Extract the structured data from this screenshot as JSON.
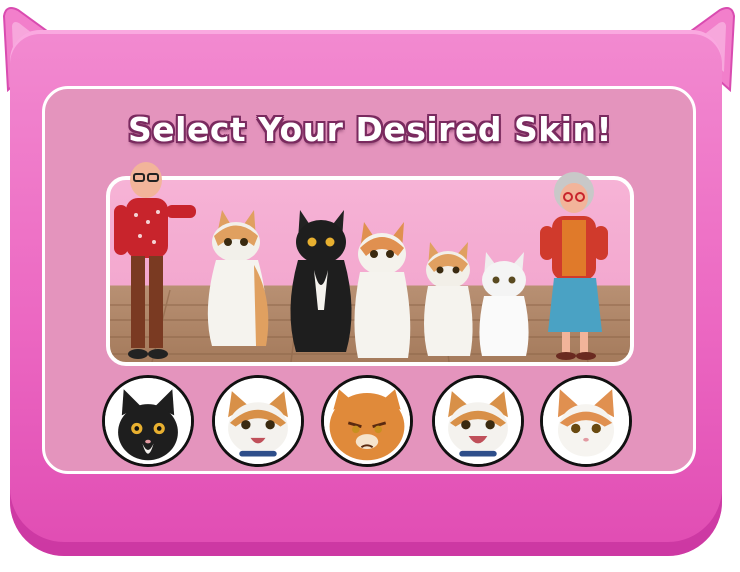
{
  "dialog": {
    "title": "Select Your Desired Skin!",
    "accent_color": "#ec68c2",
    "panel_color": "#e494bd",
    "scene_background_color": "#f3a8cf",
    "title_outline_color": "#7a2a5f"
  },
  "scene": {
    "characters": [
      {
        "name": "grandpa",
        "icon": "grandpa-character"
      },
      {
        "name": "orange-white-cat",
        "icon": "cat-character"
      },
      {
        "name": "black-white-cat",
        "icon": "cat-character"
      },
      {
        "name": "orange-white-cat",
        "icon": "cat-character"
      },
      {
        "name": "orange-white-kitten",
        "icon": "cat-character"
      },
      {
        "name": "white-cat",
        "icon": "cat-character"
      },
      {
        "name": "grandma",
        "icon": "grandma-character"
      }
    ]
  },
  "skins": [
    {
      "id": "black-cat",
      "icon": "black-cat-face"
    },
    {
      "id": "calico-cat",
      "icon": "calico-cat-face"
    },
    {
      "id": "orange-grumpy-cat",
      "icon": "orange-cat-face"
    },
    {
      "id": "calico-happy-cat",
      "icon": "calico-cat-face"
    },
    {
      "id": "orange-white-cat",
      "icon": "orange-white-cat-face"
    }
  ]
}
